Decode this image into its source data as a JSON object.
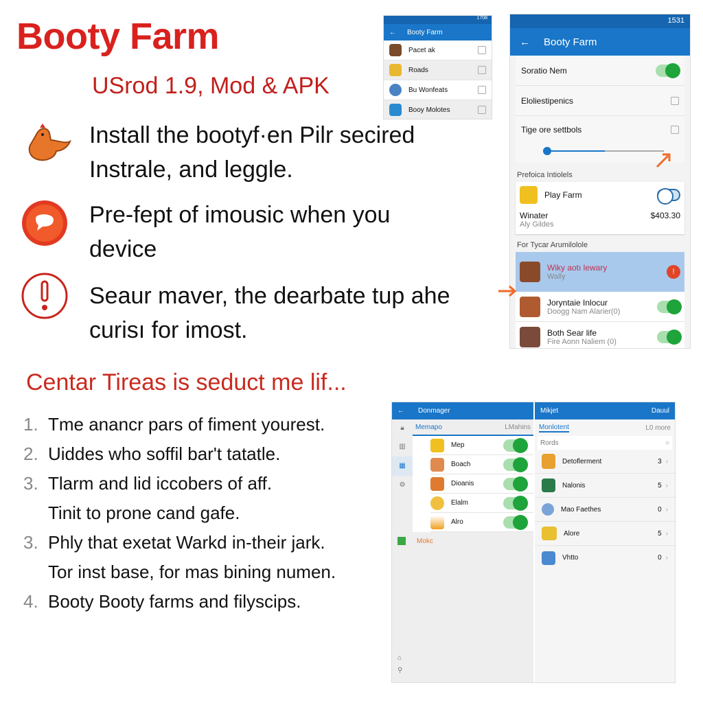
{
  "header": {
    "title": "Booty Farm",
    "subtitle": "USrod 1.9, Mod & APK"
  },
  "features": [
    {
      "icon": "chicken-icon",
      "text": "Install the bootyf·en Pilr secired Instrale, and leggle."
    },
    {
      "icon": "chat-bubble-icon",
      "text": "Pre-fept of imousic when you device"
    },
    {
      "icon": "exclamation-icon",
      "text": "Seaur maver, the dearbate tup ahe curisı for imost."
    }
  ],
  "section": {
    "heading": "Centar Tireas is seduct me lif...",
    "items": [
      {
        "num": "1.",
        "text": "Tme anancr pars of fiment yourest."
      },
      {
        "num": "2.",
        "text": "Uiddes who soffil bar't tatatle."
      },
      {
        "num": "3.",
        "text": "Tlarm and lid iccobers of aff."
      },
      {
        "num": "",
        "text": "Tinit to prone cand gafe."
      },
      {
        "num": "3.",
        "text": "Phly that exetat Warkd in-their jark."
      },
      {
        "num": "",
        "text": "Tor inst base, for mas bining numen."
      },
      {
        "num": "4.",
        "text": "Booty Booty farms and filyscips."
      }
    ]
  },
  "phone1": {
    "status": "1708",
    "title": "Booty Farm",
    "rows": [
      "Pacet ak",
      "Roads",
      "Bu Wonfeats",
      "Booy Molotes"
    ]
  },
  "phone2": {
    "status": "1531",
    "title": "Booty Farm",
    "settings": [
      {
        "label": "Soratio Nem",
        "control": "toggle-on"
      },
      {
        "label": "Eloliestipenics",
        "control": "checkbox"
      },
      {
        "label": "Tige ore settbols",
        "control": "checkbox"
      }
    ],
    "slider_value": 0.05,
    "group1": "Prefoica Intiolels",
    "play": {
      "label": "Play Farm",
      "toggle": "off"
    },
    "winater": {
      "label": "Winater",
      "sub": "Aly Gildes",
      "price": "$403.30"
    },
    "group2": "For Tycar Arumilolole",
    "items": [
      {
        "title": "Wiky aotı lewary",
        "sub": "Wally",
        "badge": "!",
        "highlight": true
      },
      {
        "title": "Joryntaie Inlocur",
        "sub": "Doogg Nam Alarier(0)",
        "toggle": "on"
      },
      {
        "title": "Both Sear life",
        "sub": "Fire Aonn Naliem (0)",
        "toggle": "on"
      }
    ]
  },
  "phone3": {
    "left": {
      "title": "Donmager",
      "tab": "Memapo",
      "tab_right": "LMahins",
      "rows": [
        "Mep",
        "Boach",
        "Dioanis",
        "Elalm",
        "Alro"
      ],
      "footer": "Mokc"
    },
    "right": {
      "title": "Mikjet",
      "action": "Dauul",
      "tab": "Monlotent",
      "tab_right": "L0 more",
      "search_placeholder": "Rords",
      "rows": [
        {
          "label": "Detoflerment",
          "count": "3"
        },
        {
          "label": "Nalonis",
          "count": "5"
        },
        {
          "label": "Mao Faethes",
          "count": "0"
        },
        {
          "label": "Alore",
          "count": "5"
        },
        {
          "label": "Vhtto",
          "count": "0"
        }
      ]
    }
  },
  "colors": {
    "brand_red": "#d9211e",
    "app_bar": "#1976c8",
    "toggle_on": "#1ea43a",
    "highlight": "#a9c9ec",
    "arrow": "#f06a28"
  }
}
